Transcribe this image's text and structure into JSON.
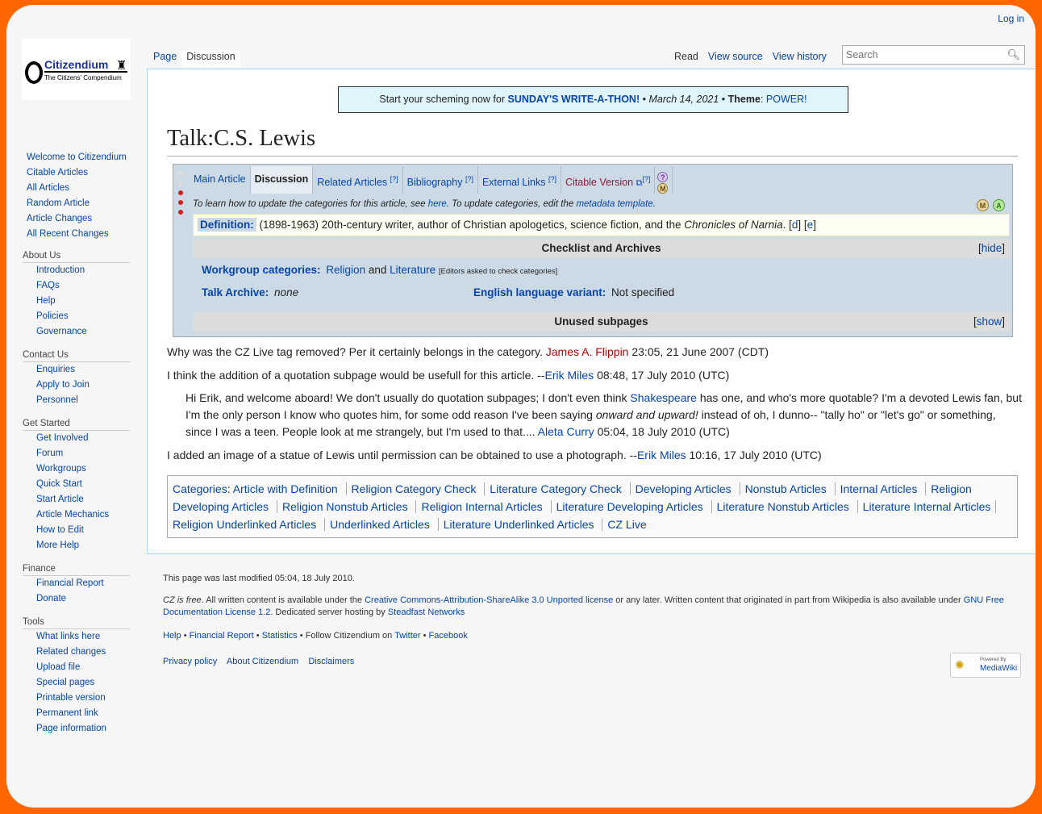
{
  "personal": {
    "login": "Log in"
  },
  "logo": {
    "name": "Citizendium",
    "tagline": "The Citizens' Compendium"
  },
  "sidebar": {
    "main": [
      "Welcome to Citizendium",
      "Citable Articles",
      "All Articles",
      "Random Article",
      "Article Changes",
      "All Recent Changes"
    ],
    "about": {
      "title": "About Us",
      "items": [
        "Introduction",
        "FAQs",
        "Help",
        "Policies",
        "Governance"
      ]
    },
    "contact": {
      "title": "Contact Us",
      "items": [
        "Enquiries",
        "Apply to Join",
        "Personnel"
      ]
    },
    "started": {
      "title": "Get Started",
      "items": [
        "Get Involved",
        "Forum",
        "Workgroups",
        "Quick Start",
        "Start Article",
        "Article Mechanics",
        "How to Edit",
        "More Help"
      ]
    },
    "finance": {
      "title": "Finance",
      "items": [
        "Financial Report",
        "Donate"
      ]
    },
    "tools": {
      "title": "Tools",
      "items": [
        "What links here",
        "Related changes",
        "Upload file",
        "Special pages",
        "Printable version",
        "Permanent link",
        "Page information"
      ]
    }
  },
  "tabs": {
    "page": "Page",
    "discussion": "Discussion",
    "read": "Read",
    "view_source": "View source",
    "view_history": "View history"
  },
  "search": {
    "placeholder": "Search"
  },
  "banner": {
    "prefix": "Start your scheming now for ",
    "link": "SUNDAY'S WRITE-A-THON!",
    "sep1": " • ",
    "date": "March 14, 2021",
    "sep2": " • ",
    "theme_label": "Theme",
    "colon": ": ",
    "theme": "POWER!"
  },
  "page": {
    "title": "Talk:C.S. Lewis"
  },
  "cluster": {
    "tabs": [
      "Main Article",
      "Discussion",
      "Related Articles",
      "Bibliography",
      "External Links",
      "Citable Version"
    ],
    "help_mark": "[?]",
    "badges": {
      "question": "?",
      "m": "M",
      "a": "A"
    },
    "learn_prefix": "To learn how to update the categories for this article, see ",
    "learn_link": "here",
    "learn_mid": ". To update categories, edit the ",
    "learn_link2": "metadata template",
    "learn_end": ".",
    "definition_label": "Definition:",
    "definition_text": " (1898-1963) 20th-century writer, author of Christian apologetics, science fiction, and the ",
    "definition_em": "Chronicles of Narnia",
    "definition_end": ".",
    "def_d": "d",
    "def_e": "e",
    "checklist": "Checklist and Archives",
    "hide": "hide",
    "wg_label": "Workgroup categories:",
    "wg_religion": "Religion",
    "wg_and": " and ",
    "wg_literature": "Literature",
    "wg_note": "[Editors asked to check categories]",
    "archive_label": "Talk Archive:",
    "archive_value": "none",
    "env_label": "English language variant:",
    "env_value": "Not specified",
    "unused": "Unused subpages",
    "show": "show"
  },
  "talk": {
    "p1_text": "Why was the CZ Live tag removed? Per it certainly belongs in the category. ",
    "p1_user": "James A. Flippin",
    "p1_time": " 23:05, 21 June 2007 (CDT)",
    "p2_text": "I think the addition of a quotation subpage would be usefull for this article. --",
    "p2_user": "Erik Miles",
    "p2_time": " 08:48, 17 July 2010 (UTC)",
    "p3_a": "Hi Erik, and welcome aboard! We don't usually do quotation subpages; I don't even think ",
    "p3_link": "Shakespeare",
    "p3_b": " has one, and who's more quotable? I'm a devoted Lewis fan, but I'm the only person I know who quotes him, for some odd reason I've been saying ",
    "p3_em1": "onward and upward!",
    "p3_c": " instead of oh, I dunno-- \"tally ho\" or \"let's go\" or something, since I was a teen. People look at me strangely, but I'm used to that.... ",
    "p3_user": "Aleta Curry",
    "p3_time": " 05:04, 18 July 2010 (UTC)",
    "p4_text": "I added an image of a statue of Lewis until permission can be obtained to use a photograph. --",
    "p4_user": "Erik Miles",
    "p4_time": " 10:16, 17 July 2010 (UTC)"
  },
  "categories": {
    "label": "Categories",
    "items": [
      "Article with Definition",
      "Religion Category Check",
      "Literature Category Check",
      "Developing Articles",
      "Nonstub Articles",
      "Internal Articles",
      "Religion Developing Articles",
      "Religion Nonstub Articles",
      "Religion Internal Articles",
      "Literature Developing Articles",
      "Literature Nonstub Articles",
      "Literature Internal Articles",
      "Religion Underlinked Articles",
      "Underlinked Articles",
      "Literature Underlinked Articles",
      "CZ Live"
    ]
  },
  "footer": {
    "modified": "This page was last modified 05:04, 18 July 2010.",
    "free": "CZ is free",
    "license_a": ". All written content is available under the ",
    "license_link": "Creative Commons-Attribution-ShareAlike 3.0 Unported license",
    "license_b": " or any later. Written content that originated in part from Wikipedia is also available under ",
    "gnu_link": "GNU Free Documentation License 1.2",
    "license_c": ". Dedicated server hosting by ",
    "host_link": "Steadfast Networks",
    "license_end": "",
    "help": "Help",
    "financial": "Financial Report",
    "statistics": "Statistics",
    "follow": "Follow Citizendium on",
    "twitter": "Twitter",
    "facebook": "Facebook",
    "bullet": "•",
    "privacy": "Privacy policy",
    "about": "About Citizendium",
    "disclaimers": "Disclaimers",
    "powered_small": "Powered By",
    "powered_big": "MediaWiki"
  }
}
